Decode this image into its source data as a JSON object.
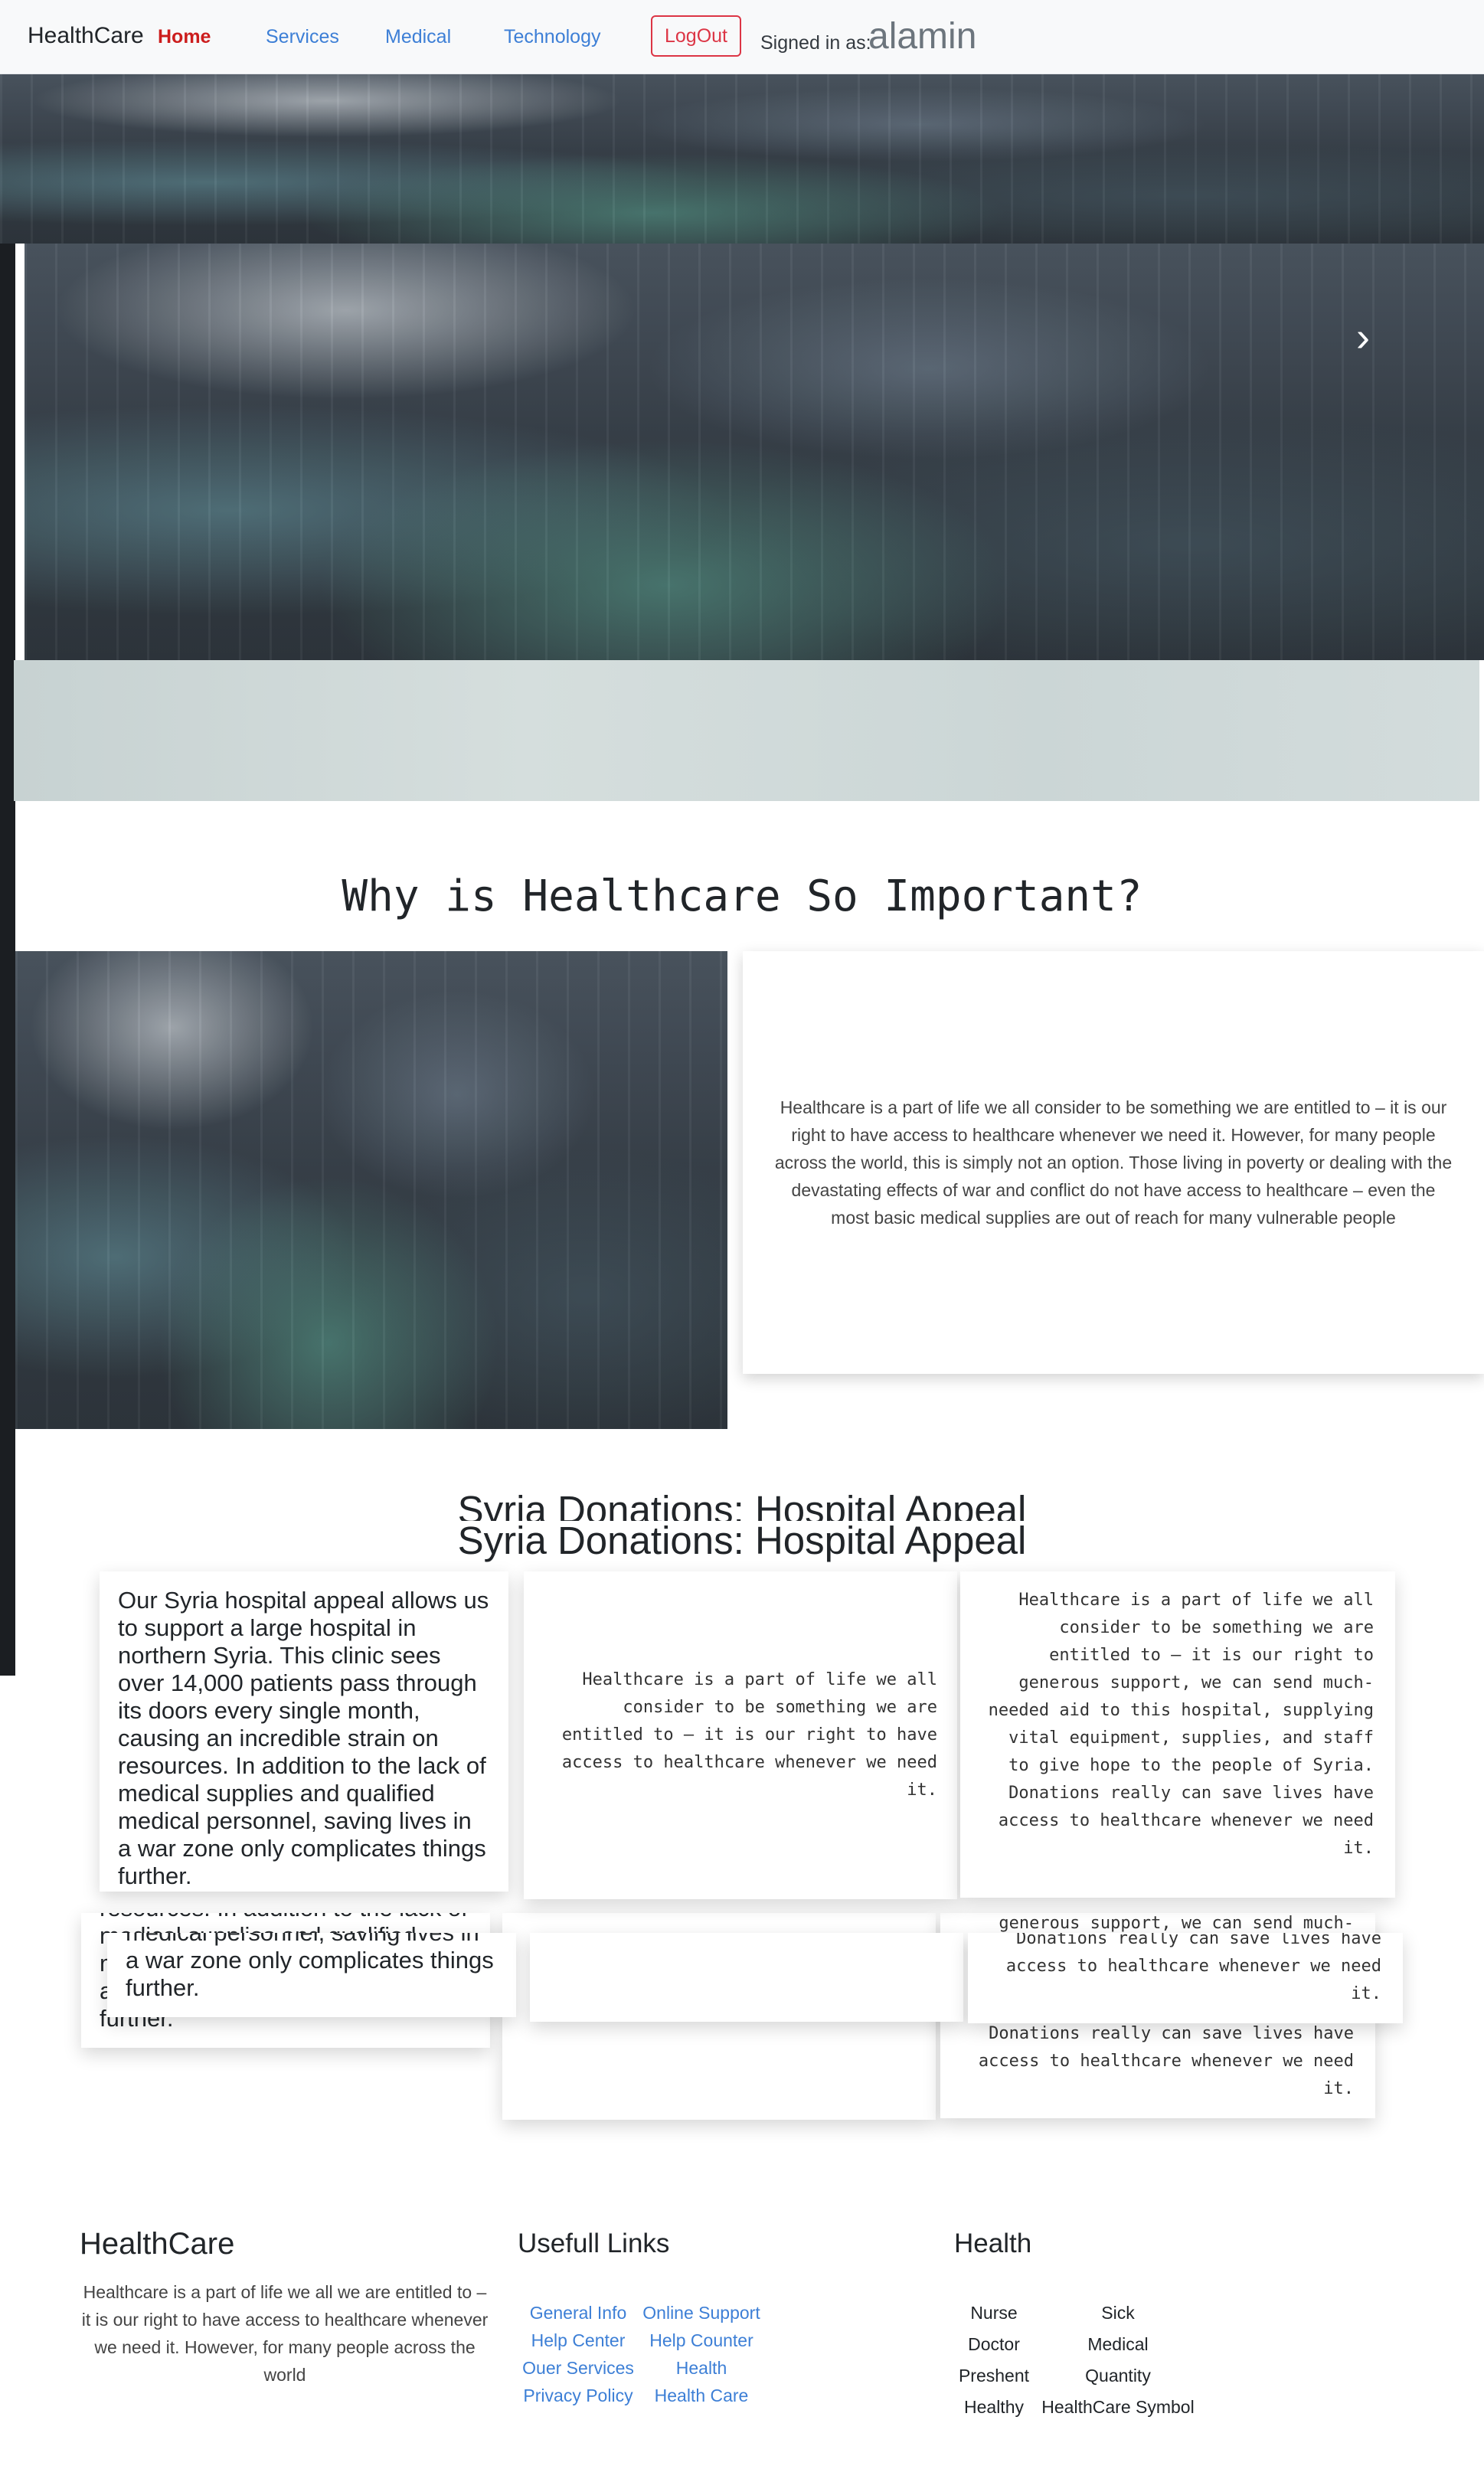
{
  "navbar": {
    "brand": "HealthCare",
    "links": [
      "Home",
      "Services",
      "Medical",
      "Technology"
    ],
    "logout": "LogOut",
    "signed_in_label": "Signed in as:",
    "username": "alamin"
  },
  "carousel": {
    "next_icon": "chevron-right-icon"
  },
  "why": {
    "title": "Why is Healthcare So Important?",
    "text": "Healthcare is a part of life we all consider to be something we are entitled to – it is our right to have access to healthcare whenever we need it. However, for many people across the world, this is simply not an option. Those living in poverty or dealing with the devastating effects of war and conflict do not have access to healthcare – even the most basic medical supplies are out of reach for many vulnerable people"
  },
  "syria": {
    "title": "Syria Donations: Hospital Appeal",
    "card1": "Our Syria hospital appeal allows us to support a large hospital in northern Syria. This clinic sees over 14,000 patients pass through its doors every single month, causing an incredible strain on resources. In addition to the lack of medical supplies and qualified medical personnel, saving lives in a war zone only complicates things further.",
    "card2": "Healthcare is a part of life we all consider to be something we are entitled to – it is our right to have access to healthcare whenever we need it.",
    "card3": "Healthcare is a part of life we all consider to be something we are entitled to – it is our right to generous support, we can send much-needed aid to this hospital, supplying vital equipment, supplies, and staff to give hope to the people of Syria. Donations really can save lives have access to healthcare whenever we need it."
  },
  "footer": {
    "brand": "HealthCare",
    "text": "Healthcare is a part of life we all we are entitled to – it is our right to have access to healthcare whenever we need it. However, for many people across the world",
    "links_title": "Usefull Links",
    "links": [
      [
        "General Info",
        "Online Support"
      ],
      [
        "Help Center",
        "Help Counter"
      ],
      [
        "Ouer Services",
        "Health"
      ],
      [
        "Privacy Policy",
        "Health Care"
      ]
    ],
    "health_title": "Health",
    "health_items": [
      [
        "Nurse",
        "Sick"
      ],
      [
        "Doctor",
        "Medical"
      ],
      [
        "Preshent",
        "Quantity"
      ],
      [
        "Healthy",
        "HealthCare Symbol"
      ]
    ]
  },
  "colors": {
    "link": "#3d7fd6",
    "active": "#cc1d1d",
    "logout": "#dc3545"
  }
}
